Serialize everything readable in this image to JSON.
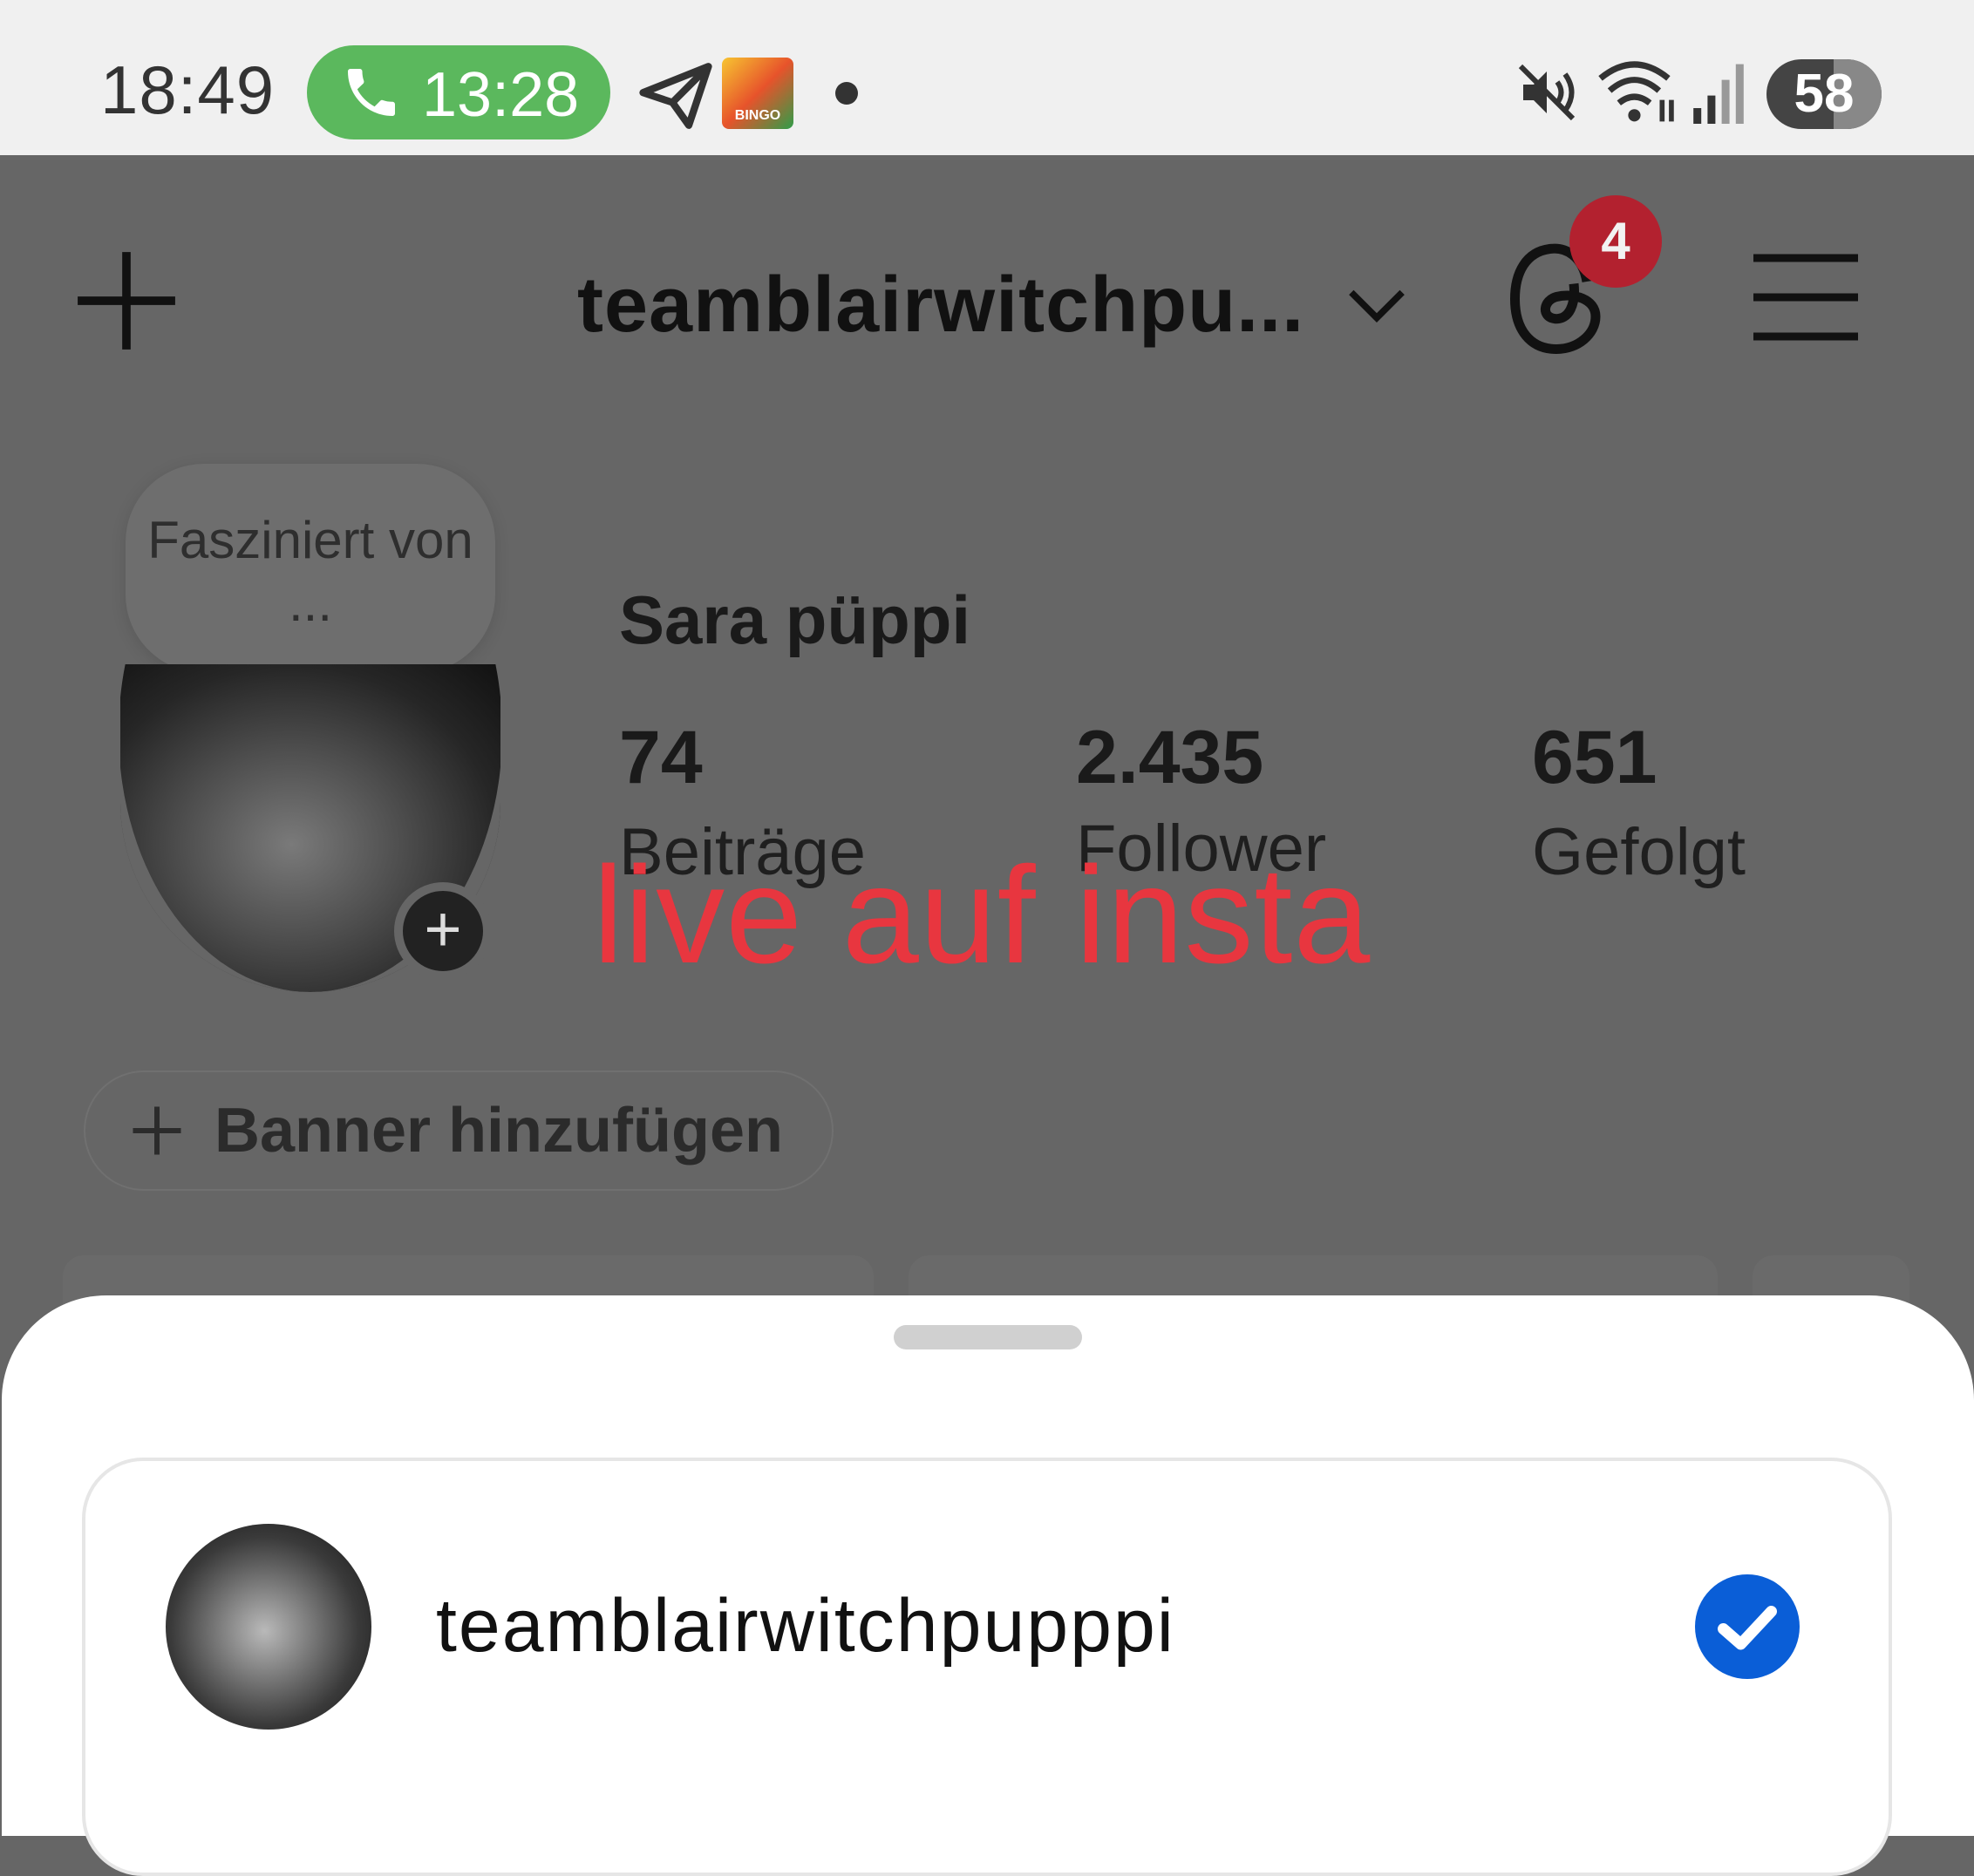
{
  "status_bar": {
    "time": "18:49",
    "call_timer": "13:28",
    "battery_level": "58",
    "icons": [
      "phone-icon",
      "telegram-icon",
      "bingo-app-icon",
      "notification-dot",
      "mute-icon",
      "wifi-icon",
      "signal-icon",
      "battery-icon"
    ]
  },
  "header": {
    "account_title": "teamblairwitchpu...",
    "threads_badge_count": "4",
    "icons": [
      "add-post-icon",
      "chevron-down-icon",
      "threads-icon",
      "menu-icon"
    ]
  },
  "profile": {
    "note": "Fasziniert von ...",
    "display_name": "Sara püppi",
    "stats": [
      {
        "value": "74",
        "label": "Beiträge"
      },
      {
        "value": "2.435",
        "label": "Follower"
      },
      {
        "value": "651",
        "label": "Gefolgt"
      }
    ],
    "banner_button_label": "Banner hinzufügen"
  },
  "overlay_caption": "live auf insta",
  "sheet": {
    "account": {
      "username": "teamblairwitchpupppi",
      "selected": true
    }
  },
  "colors": {
    "call_green": "#5bb85d",
    "badge_red": "#b3212f",
    "overlay_text_red": "#e8363f",
    "check_blue": "#0a5ed7",
    "dim_background": "#666666"
  }
}
